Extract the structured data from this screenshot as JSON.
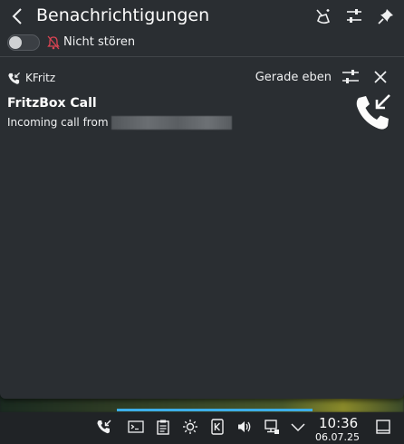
{
  "header": {
    "title": "Benachrichtigungen",
    "dnd_label": "Nicht stören",
    "dnd_enabled": false
  },
  "notification": {
    "app_name": "KFritz",
    "time": "Gerade eben",
    "title": "FritzBox Call",
    "body": "Incoming call from"
  },
  "clock": {
    "time": "10:36",
    "date": "06.07.25"
  },
  "colors": {
    "accent": "#3daee9",
    "panel": "#2a2e32",
    "taskbar": "#202326"
  },
  "icons": {
    "back": "chevron-left-icon",
    "clear": "broom-icon",
    "configure": "sliders-icon",
    "pin": "pin-icon",
    "dnd": "bell-muted-icon",
    "app": "incoming-call-icon",
    "notif_settings": "sliders-icon",
    "close": "close-icon",
    "big": "incoming-call-icon",
    "tray": [
      "incoming-call-icon",
      "terminal-icon",
      "clipboard-icon",
      "brightness-icon",
      "kde-connect-icon",
      "volume-icon",
      "network-icon",
      "chevron-down-icon",
      "show-desktop-icon"
    ]
  }
}
